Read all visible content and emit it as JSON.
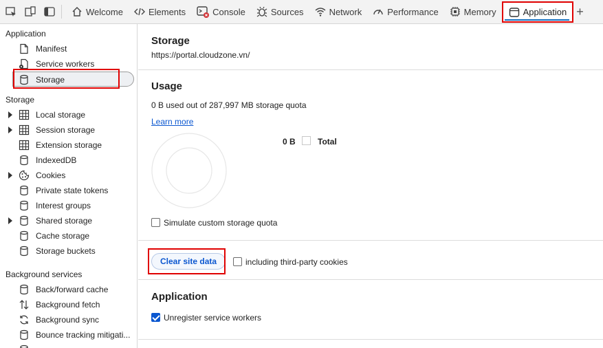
{
  "tabs": [
    {
      "label": "Welcome",
      "icon": "home-icon"
    },
    {
      "label": "Elements",
      "icon": "code-icon"
    },
    {
      "label": "Console",
      "icon": "console-icon"
    },
    {
      "label": "Sources",
      "icon": "bug-icon"
    },
    {
      "label": "Network",
      "icon": "wifi-icon"
    },
    {
      "label": "Performance",
      "icon": "gauge-icon"
    },
    {
      "label": "Memory",
      "icon": "chip-icon"
    },
    {
      "label": "Application",
      "icon": "window-icon",
      "active": true
    }
  ],
  "sidebar": {
    "application_title": "Application",
    "application_items": [
      "Manifest",
      "Service workers",
      "Storage"
    ],
    "storage_title": "Storage",
    "storage_items": [
      "Local storage",
      "Session storage",
      "Extension storage",
      "IndexedDB",
      "Cookies",
      "Private state tokens",
      "Interest groups",
      "Shared storage",
      "Cache storage",
      "Storage buckets"
    ],
    "background_title": "Background services",
    "background_items": [
      "Back/forward cache",
      "Background fetch",
      "Background sync",
      "Bounce tracking mitigati..."
    ]
  },
  "main": {
    "title": "Storage",
    "origin": "https://portal.cloudzone.vn/",
    "usage": {
      "heading": "Usage",
      "summary": "0 B used out of 287,997 MB storage quota",
      "learn_more": "Learn more",
      "legend_value": "0 B",
      "legend_label": "Total",
      "simulate_label": "Simulate custom storage quota",
      "simulate_checked": false
    },
    "clear": {
      "button_label": "Clear site data",
      "third_party_label": "including third-party cookies",
      "third_party_checked": false
    },
    "application": {
      "heading": "Application",
      "unregister_label": "Unregister service workers",
      "unregister_checked": true
    }
  },
  "colors": {
    "highlight": "#e00000",
    "accent": "#0b57d0"
  }
}
